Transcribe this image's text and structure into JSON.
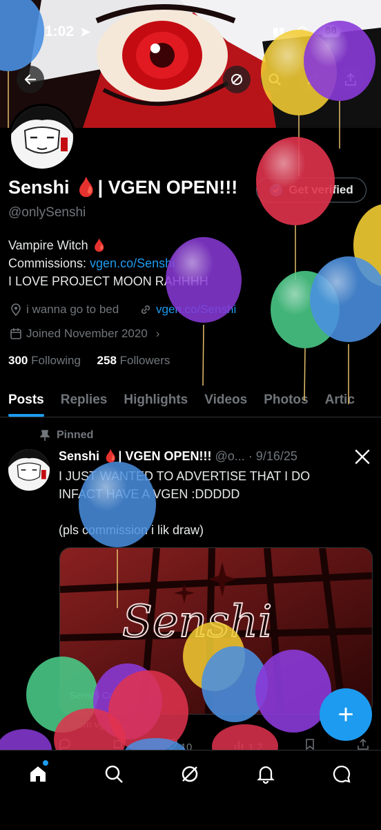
{
  "status_bar": {
    "time": "1:02",
    "battery": "88"
  },
  "profile": {
    "display_name": "Senshi 🩸| VGEN OPEN!!!",
    "handle": "@onlySenshi",
    "get_verified_label": "Get verified",
    "bio_line1_text": "Vampire Witch 🩸",
    "bio_line2_prefix": "Commissions: ",
    "bio_line2_link": "vgen.co/Senshi",
    "bio_line3": "I LOVE PROJECT MOON RAHHHH",
    "location": "i wanna go to bed",
    "website": "vgen.co/Senshi",
    "joined": "Joined November 2020",
    "following_count": "300",
    "following_label": "Following",
    "followers_count": "258",
    "followers_label": "Followers"
  },
  "tabs": [
    "Posts",
    "Replies",
    "Highlights",
    "Videos",
    "Photos",
    "Artic"
  ],
  "pinned_post": {
    "pinned_label": "Pinned",
    "author_name": "Senshi 🩸| VGEN OPEN!!!",
    "author_handle": "@o...",
    "date": "· 9/16/25",
    "text_line1": "I JUST WANTED TO ADVERTISE THAT I DO",
    "text_line2": "INFACT HAVE A VGEN :DDDDD",
    "text_line3": "(pls commission i lik draw)",
    "media_title": "Senshi",
    "card_caption": "Senshi Comm...",
    "card_domain": "From vgen.co",
    "reply_count": "",
    "like_count": "10",
    "view_count": "1.2"
  },
  "colors": {
    "accent": "#1d9bf0",
    "text_primary": "#e7e9ea",
    "text_secondary": "#71767b",
    "blood_red": "#d0021b"
  },
  "icons": {
    "back": "back-arrow-icon",
    "search": "search-icon",
    "share": "share-icon",
    "location": "location-icon",
    "link": "link-icon",
    "calendar": "calendar-icon",
    "pin": "pin-icon",
    "x_logo": "x-logo-icon",
    "home": "home-icon",
    "explore": "search-icon",
    "grok": "grok-icon",
    "notifications": "bell-icon",
    "messages": "message-icon",
    "compose": "plus-icon"
  }
}
